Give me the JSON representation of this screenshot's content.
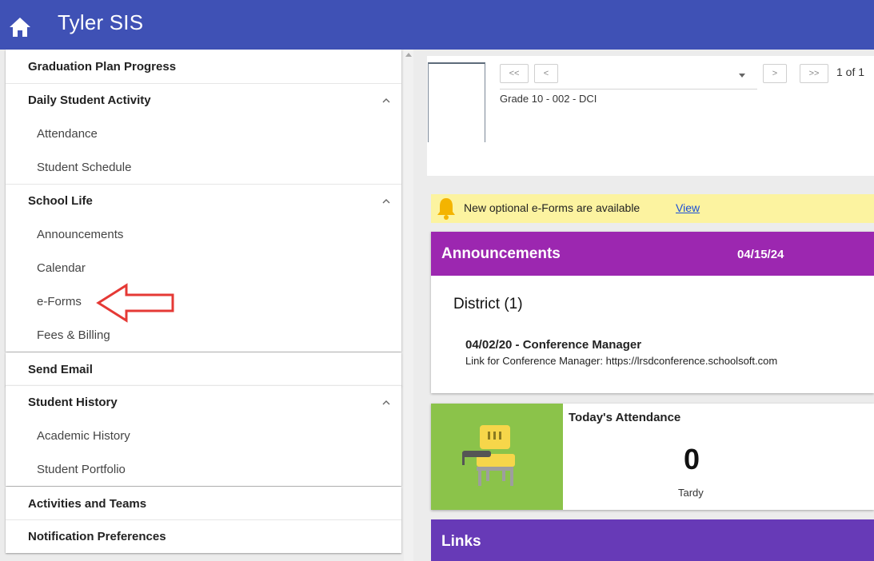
{
  "app": {
    "title": "Tyler SIS"
  },
  "sidebar": {
    "graduation_plan": "Graduation Plan Progress",
    "daily_activity": {
      "label": "Daily Student Activity",
      "items": [
        "Attendance",
        "Student Schedule"
      ]
    },
    "school_life": {
      "label": "School Life",
      "items": [
        "Announcements",
        "Calendar",
        "e-Forms",
        "Fees & Billing"
      ]
    },
    "send_email": "Send Email",
    "student_history": {
      "label": "Student History",
      "items": [
        "Academic History",
        "Student Portfolio"
      ]
    },
    "activities": "Activities and Teams",
    "notification_prefs": "Notification Preferences"
  },
  "student_nav": {
    "first": "<<",
    "prev": "<",
    "next": ">",
    "last": ">>",
    "page": "1 of 1",
    "grade": "Grade 10 - 002 - DCI"
  },
  "banner": {
    "text": "New optional e-Forms are available",
    "link": "View"
  },
  "announcements": {
    "title": "Announcements",
    "date": "04/15/24",
    "group": "District (1)",
    "item_title": "04/02/20 - Conference Manager",
    "item_body": "Link for Conference Manager: https://lrsdconference.schoolsoft.com"
  },
  "attendance": {
    "title": "Today's Attendance",
    "count": "0",
    "label": "Tardy"
  },
  "links": {
    "title": "Links"
  },
  "colors": {
    "header": "#3f51b5",
    "announcements": "#9c27b0",
    "attendance_tile": "#8bc34a",
    "links": "#673ab7",
    "banner": "#fcf3a0",
    "annotation_arrow": "#e53935"
  },
  "icons": [
    "home-icon",
    "chevron-up-icon",
    "bell-icon",
    "chair-icon",
    "red-arrow-annotation"
  ]
}
